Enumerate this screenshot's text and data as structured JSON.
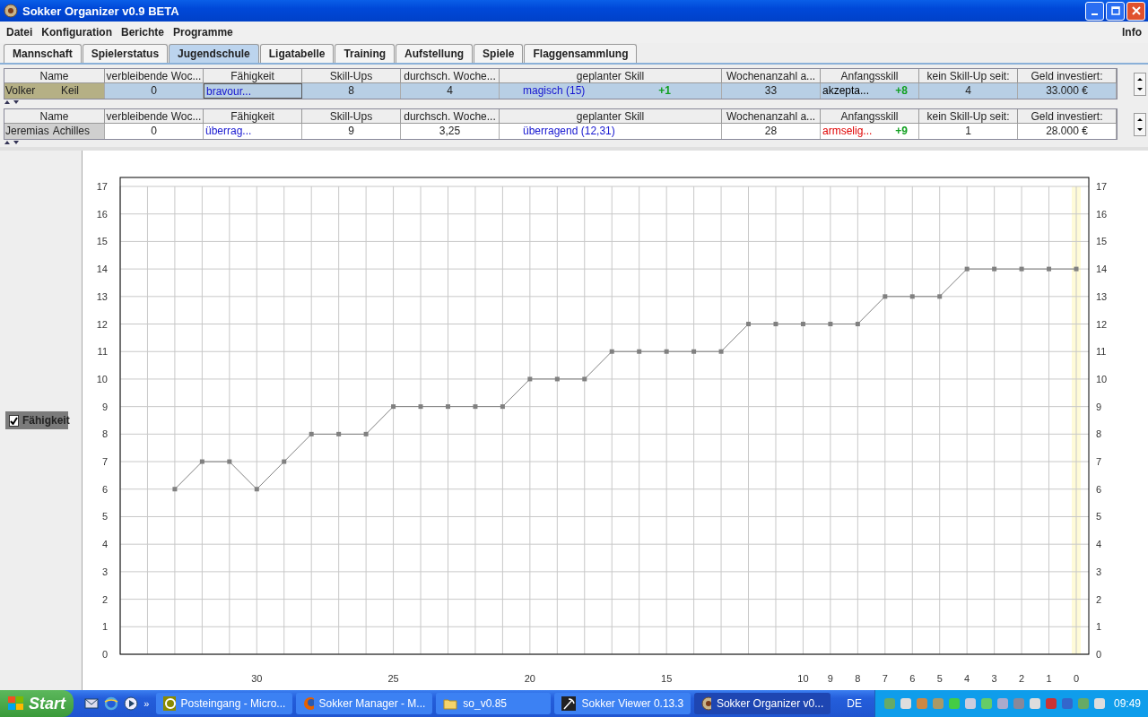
{
  "window": {
    "title": "Sokker Organizer v0.9 BETA"
  },
  "menu": [
    {
      "label": "Datei"
    },
    {
      "label": "Konfiguration"
    },
    {
      "label": "Berichte"
    },
    {
      "label": "Programme"
    }
  ],
  "menu_right": "Info",
  "tabs": [
    {
      "label": "Mannschaft",
      "selected": false
    },
    {
      "label": "Spielerstatus",
      "selected": false
    },
    {
      "label": "Jugendschule",
      "selected": true
    },
    {
      "label": "Ligatabelle",
      "selected": false
    },
    {
      "label": "Training",
      "selected": false
    },
    {
      "label": "Aufstellung",
      "selected": false
    },
    {
      "label": "Spiele",
      "selected": false
    },
    {
      "label": "Flaggensammlung",
      "selected": false
    }
  ],
  "tables": [
    {
      "columns": [
        "Name",
        "verbleibende Woc...",
        "Fähigkeit",
        "Skill-Ups",
        "durchsch. Woche...",
        "geplanter Skill",
        "Wochenanzahl a...",
        "Anfangsskill",
        "kein Skill-Up seit:",
        "Geld investiert:"
      ],
      "rows": [
        {
          "selected": true,
          "first_name": "Volker",
          "last_name": "Keil",
          "remaining": "0",
          "skill": "bravour...",
          "skill_ups": "8",
          "avg_weeks": "4",
          "planned": "magisch (15)",
          "planned_delta": "+1",
          "weeks": "33",
          "start_skill": {
            "text": "akzepta...",
            "color": "#000000"
          },
          "start_delta": "+8",
          "no_up_since": "4",
          "money": "33.000 €"
        }
      ]
    },
    {
      "columns": [
        "Name",
        "verbleibende Woc...",
        "Fähigkeit",
        "Skill-Ups",
        "durchsch. Woche...",
        "geplanter Skill",
        "Wochenanzahl a...",
        "Anfangsskill",
        "kein Skill-Up seit:",
        "Geld investiert:"
      ],
      "rows": [
        {
          "selected": false,
          "first_name": "Jeremias",
          "last_name": "Achilles",
          "remaining": "0",
          "skill": "überrag...",
          "skill_ups": "9",
          "avg_weeks": "3,25",
          "planned": "überragend (12,31)",
          "planned_delta": "",
          "weeks": "28",
          "start_skill": {
            "text": "armselig...",
            "color": "#e00000"
          },
          "start_delta": "+9",
          "no_up_since": "1",
          "money": "28.000 €"
        }
      ]
    }
  ],
  "legend": [
    {
      "checked": true
    }
  ],
  "chart": {
    "chart_data": {
      "type": "line",
      "x": [
        33,
        32,
        31,
        30,
        29,
        28,
        27,
        26,
        25,
        24,
        23,
        22,
        21,
        20,
        19,
        18,
        17,
        16,
        15,
        14,
        13,
        12,
        11,
        10,
        9,
        8,
        7,
        6,
        5,
        4,
        3,
        2,
        1,
        0
      ],
      "grid": true,
      "ref_lines": [
        {
          "axis": "x",
          "value": 0,
          "color": "#fffbd8"
        }
      ],
      "series": [
        {
          "name": "Fähigkeit",
          "color": "#808080",
          "marker": "square",
          "values": [
            6,
            7,
            7,
            6,
            7,
            8,
            8,
            8,
            9,
            9,
            9,
            9,
            9,
            10,
            10,
            10,
            11,
            11,
            11,
            11,
            11,
            12,
            12,
            12,
            12,
            12,
            13,
            13,
            13,
            14,
            14,
            14,
            14,
            14
          ]
        }
      ],
      "xlim": [
        35,
        0
      ],
      "ylim": [
        0,
        17
      ],
      "xticks": [
        30,
        25,
        20,
        15,
        10,
        9,
        8,
        7,
        6,
        5,
        4,
        3,
        2,
        1,
        0
      ],
      "yticks": [
        0,
        1,
        2,
        3,
        4,
        5,
        6,
        7,
        8,
        9,
        10,
        11,
        12,
        13,
        14,
        15,
        16,
        17
      ]
    },
    "right_axis_labels": [
      "17",
      "16",
      "15",
      "14",
      "13",
      "12",
      "11",
      "10",
      "9",
      "8",
      "7",
      "6",
      "5",
      "4",
      "3",
      "2",
      "1",
      "0"
    ]
  },
  "taskbar": {
    "start": "Start",
    "more": "»",
    "tasks": [
      {
        "label": "Posteingang - Micro...",
        "selected": false
      },
      {
        "label": "Sokker Manager - M...",
        "selected": false
      },
      {
        "label": "so_v0.85",
        "selected": false
      },
      {
        "label": "Sokker Viewer 0.13.3",
        "selected": false
      },
      {
        "label": "Sokker Organizer v0...",
        "selected": true
      }
    ],
    "language": "DE",
    "clock": "09:49"
  }
}
